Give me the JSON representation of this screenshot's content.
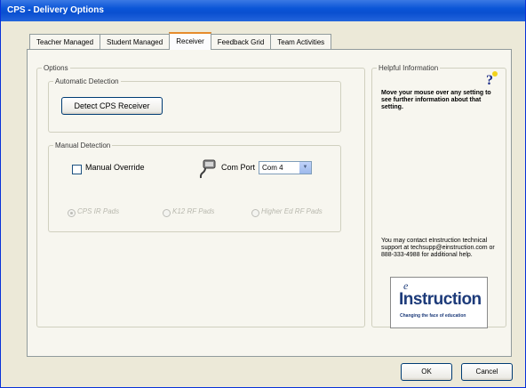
{
  "window": {
    "title": "CPS - Delivery Options"
  },
  "tabs": [
    {
      "label": "Teacher Managed",
      "active": false
    },
    {
      "label": "Student Managed",
      "active": false
    },
    {
      "label": "Receiver",
      "active": true
    },
    {
      "label": "Feedback Grid",
      "active": false
    },
    {
      "label": "Team Activities",
      "active": false
    }
  ],
  "options": {
    "legend": "Options",
    "automatic": {
      "legend": "Automatic Detection",
      "detect_button": "Detect CPS Receiver"
    },
    "manual": {
      "legend": "Manual Detection",
      "override_label": "Manual Override",
      "override_checked": false,
      "com_port_label": "Com Port",
      "com_port_value": "Com 4",
      "pads": [
        {
          "label": "CPS IR Pads",
          "selected": true,
          "enabled": false
        },
        {
          "label": "K12 RF Pads",
          "selected": false,
          "enabled": false
        },
        {
          "label": "Higher Ed RF Pads",
          "selected": false,
          "enabled": false
        }
      ]
    }
  },
  "help": {
    "legend": "Helpful Information",
    "hint": "Move your mouse over any setting to see further information about that setting.",
    "contact": "You may contact eInstruction technical support at techsupp@einstruction.com or 888-333-4988 for additional help.",
    "logo_letter": "e",
    "logo_word": "Instruction",
    "logo_tagline": "Changing the face of education"
  },
  "footer": {
    "ok_label": "OK",
    "cancel_label": "Cancel"
  },
  "colors": {
    "titlebar": "#0a55d7",
    "active_tab_accent": "#e68b2c",
    "logo_blue": "#1d3b7a"
  }
}
